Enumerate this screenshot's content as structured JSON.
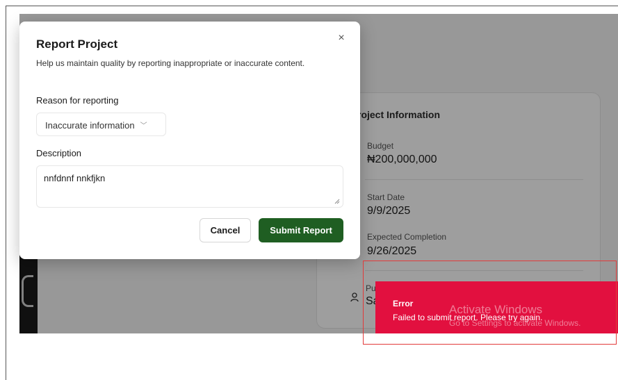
{
  "modal": {
    "title": "Report Project",
    "description": "Help us maintain quality by reporting inappropriate or inaccurate content.",
    "close_glyph": "×",
    "reason_label": "Reason for reporting",
    "reason_selected": "Inaccurate information",
    "description_label": "Description",
    "description_value": "nnfdnnf nnkfjkn",
    "cancel_label": "Cancel",
    "submit_label": "Submit Report"
  },
  "project_info": {
    "title": "roject Information",
    "budget_label": "Budget",
    "budget_value": "₦200,000,000",
    "start_label": "Start Date",
    "start_value": "9/9/2025",
    "completion_label": "Expected Completion",
    "completion_value": "9/26/2025",
    "partial_label": "Pu",
    "partial_value": "Sa"
  },
  "toast": {
    "title": "Error",
    "message": "Failed to submit report. Please try again."
  },
  "watermark": {
    "title": "Activate Windows",
    "subtitle": "Go to Settings to activate Windows."
  },
  "colors": {
    "submit_green": "#1f5e22",
    "error_red": "#e2103f"
  }
}
